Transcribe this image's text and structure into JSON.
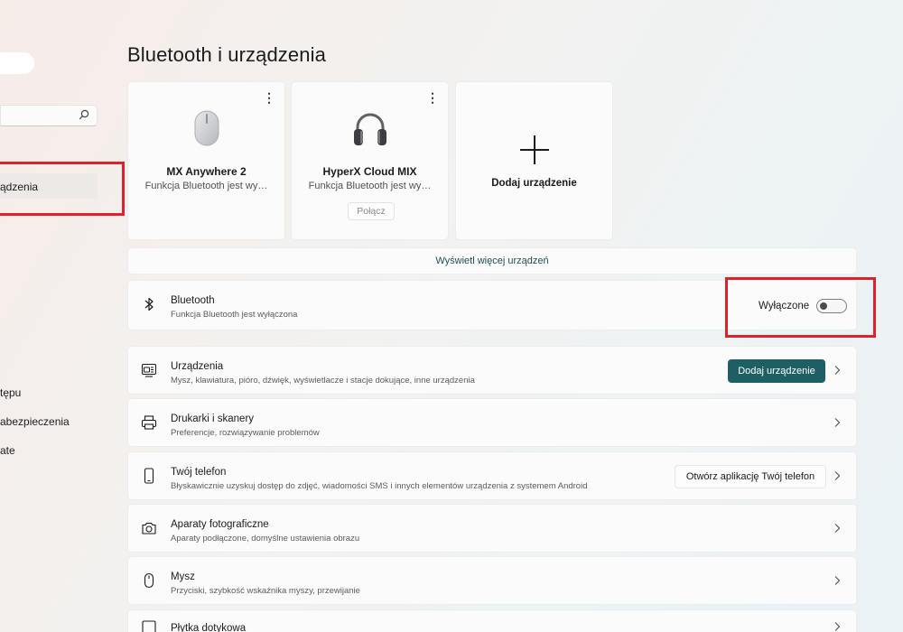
{
  "sidebar": {
    "active_item": "ądzenia",
    "items": [
      "tępu",
      "abezpieczenia",
      "ate"
    ]
  },
  "page_title": "Bluetooth i urządzenia",
  "devices": [
    {
      "name": "MX Anywhere 2",
      "status": "Funkcja Bluetooth jest wy…",
      "icon": "mouse-icon"
    },
    {
      "name": "HyperX Cloud MIX",
      "status": "Funkcja Bluetooth jest wy…",
      "icon": "headphones-icon",
      "connect_label": "Połącz"
    }
  ],
  "add_device_card": {
    "label": "Dodaj urządzenie",
    "icon": "plus-icon"
  },
  "show_more_label": "Wyświetl więcej urządzeń",
  "bluetooth": {
    "title": "Bluetooth",
    "subtitle": "Funkcja Bluetooth jest wyłączona",
    "state_label": "Wyłączone",
    "enabled": false
  },
  "rows": [
    {
      "title": "Urządzenia",
      "subtitle": "Mysz, klawiatura, pióro, dźwięk, wyświetlacze i stacje dokujące, inne urządzenia",
      "icon": "devices-icon",
      "action_label": "Dodaj urządzenie"
    },
    {
      "title": "Drukarki i skanery",
      "subtitle": "Preferencje, rozwiązywanie problemów",
      "icon": "printer-icon"
    },
    {
      "title": "Twój telefon",
      "subtitle": "Błyskawicznie uzyskuj dostęp do zdjęć, wiadomości SMS i innych elementów urządzenia z systemem Android",
      "icon": "phone-icon",
      "action_label": "Otwórz aplikację Twój telefon"
    },
    {
      "title": "Aparaty fotograficzne",
      "subtitle": "Aparaty podłączone, domyślne ustawienia obrazu",
      "icon": "camera-icon"
    },
    {
      "title": "Mysz",
      "subtitle": "Przyciski, szybkość wskaźnika myszy, przewijanie",
      "icon": "mouse-icon"
    },
    {
      "title": "Płytka dotykowa",
      "subtitle": "",
      "icon": "touchpad-icon"
    }
  ],
  "colors": {
    "accent": "#1e5f63",
    "highlight_box": "#e0202a"
  }
}
